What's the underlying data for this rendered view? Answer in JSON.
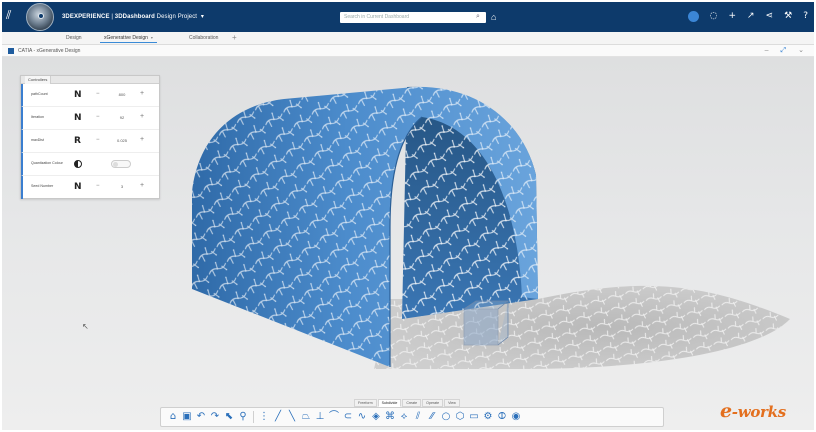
{
  "header": {
    "brand": "3DEXPERIENCE",
    "separator": " | ",
    "app_name": "3DDashboard",
    "project": "Design Project",
    "search_placeholder": "Search in Current Dashboard"
  },
  "tabs": [
    {
      "label": "Design"
    },
    {
      "label": "xGenerative Design",
      "active": true
    },
    {
      "label": "Collaboration"
    }
  ],
  "breadcrumb": {
    "text": "CATIA - xGenerative Design"
  },
  "params_panel": {
    "tab_label": "Controllers",
    "rows": [
      {
        "label": "pathCount",
        "glyph": "N",
        "value": "800"
      },
      {
        "label": "Iteration",
        "glyph": "N",
        "value": "92"
      },
      {
        "label": "maxDist",
        "glyph": "R",
        "value": "0.025"
      },
      {
        "label": "Quantization Colour",
        "glyph": "contrast",
        "value": ""
      },
      {
        "label": "Seed Number",
        "glyph": "N",
        "value": "3"
      }
    ]
  },
  "command_tabs": [
    "Freeform",
    "Subdivide",
    "Create",
    "Operate",
    "View"
  ],
  "active_command_tab": "Subdivide",
  "watermark": {
    "first": "e",
    "rest": "-works"
  },
  "colors": {
    "header": "#0d3a6b",
    "surface": "#3e7fc0",
    "accent": "#3a8bd7"
  }
}
